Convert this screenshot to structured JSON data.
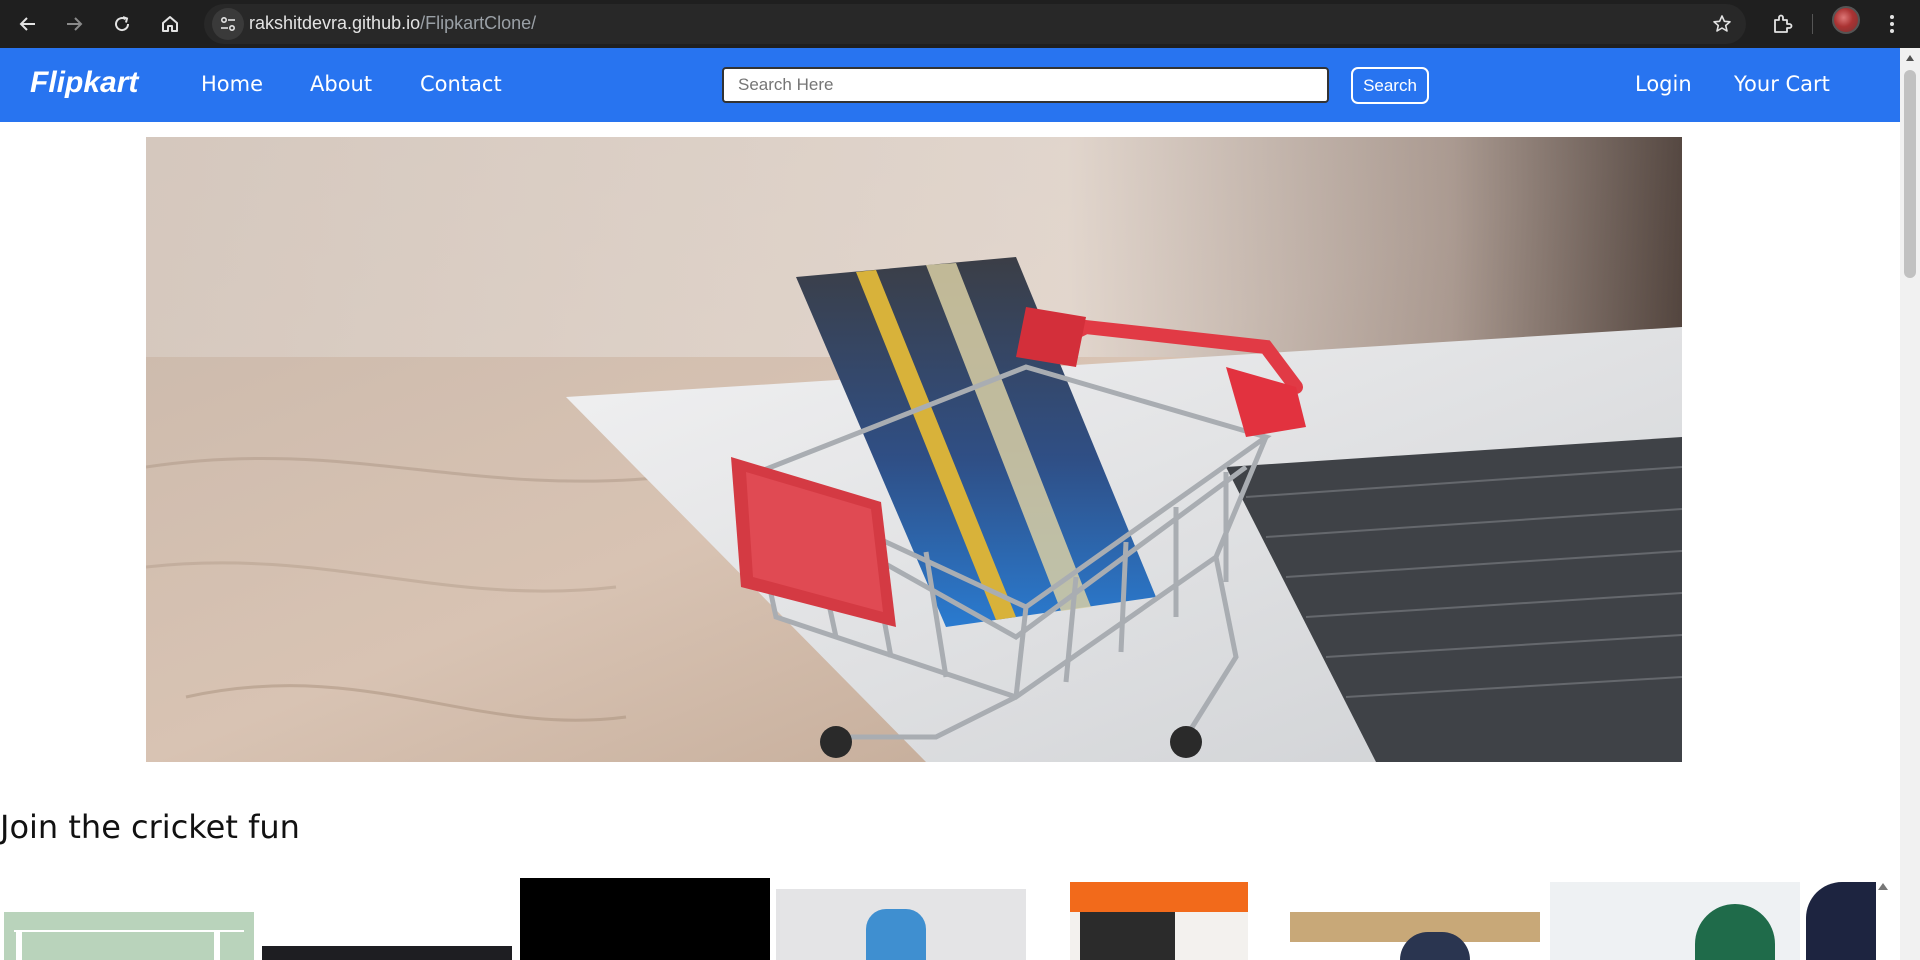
{
  "browser": {
    "url_host": "rakshitdevra.github.io",
    "url_path": "/FlipkartClone/"
  },
  "navbar": {
    "logo": "Flipkart",
    "links": [
      "Home",
      "About",
      "Contact"
    ],
    "search_placeholder": "Search Here",
    "search_button": "Search",
    "login": "Login",
    "cart": "Your Cart"
  },
  "section": {
    "title": "Join the cricket fun"
  },
  "colors": {
    "brand": "#2874f0",
    "chrome": "#1f1f1f"
  }
}
